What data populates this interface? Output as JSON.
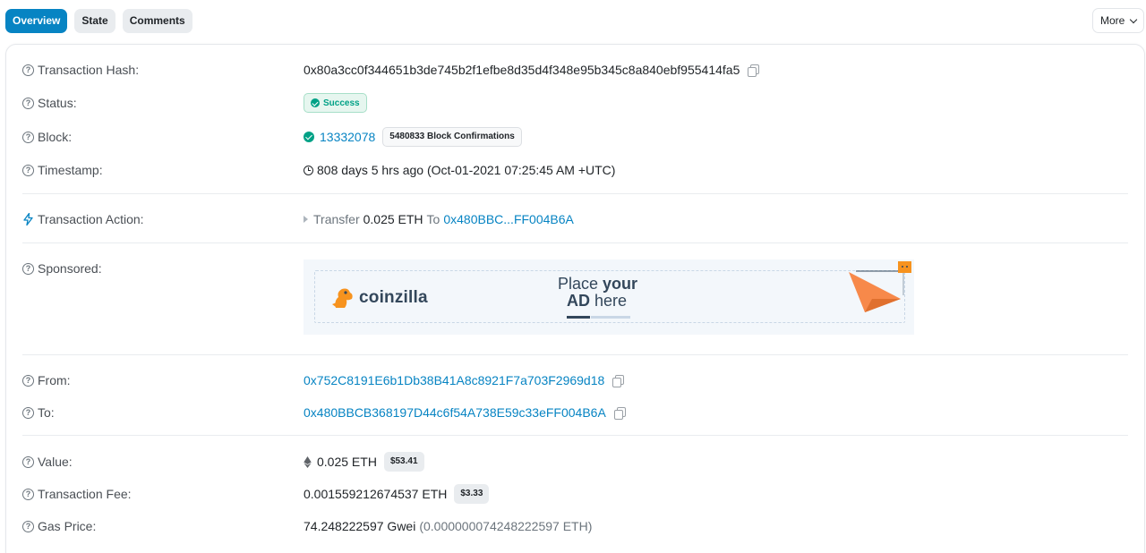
{
  "tabs": [
    {
      "label": "Overview",
      "active": true
    },
    {
      "label": "State",
      "active": false
    },
    {
      "label": "Comments",
      "active": false
    }
  ],
  "more_label": "More",
  "rows": {
    "tx_hash": {
      "label": "Transaction Hash:",
      "value": "0x80a3cc0f344651b3de745b2f1efbe8d35d4f348e95b345c8a840ebf955414fa5"
    },
    "status": {
      "label": "Status:",
      "value": "Success"
    },
    "block": {
      "label": "Block:",
      "number": "13332078",
      "confirmations": "5480833 Block Confirmations"
    },
    "timestamp": {
      "label": "Timestamp:",
      "value": "808 days 5 hrs ago (Oct-01-2021 07:25:45 AM +UTC)"
    },
    "action": {
      "label": "Transaction Action:",
      "verb": "Transfer",
      "amount": "0.025 ETH",
      "to_word": "To",
      "to_address": "0x480BBC...FF004B6A"
    },
    "sponsored": {
      "label": "Sponsored:",
      "brand": "coinzilla",
      "place_line1_a": "Place ",
      "place_line1_b": "your",
      "place_line2_a": "AD",
      "place_line2_b": " here"
    },
    "from": {
      "label": "From:",
      "value": "0x752C8191E6b1Db38B41A8c8921F7a703F2969d18"
    },
    "to": {
      "label": "To:",
      "value": "0x480BBCB368197D44c6f54A738E59c33eFF004B6A"
    },
    "value": {
      "label": "Value:",
      "amount": "0.025 ETH",
      "usd": "$53.41"
    },
    "fee": {
      "label": "Transaction Fee:",
      "amount": "0.001559212674537 ETH",
      "usd": "$3.33"
    },
    "gas": {
      "label": "Gas Price:",
      "gwei": "74.248222597 Gwei",
      "eth": "(0.000000074248222597 ETH)"
    }
  },
  "colors": {
    "accent": "#0784c3",
    "success": "#00a186",
    "ad_orange": "#f7894a"
  }
}
